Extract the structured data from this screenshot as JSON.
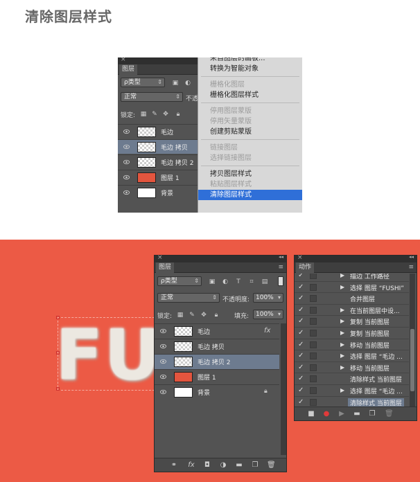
{
  "page_title": "清除图层样式",
  "top_panel": {
    "close": "×",
    "tab": "图层",
    "filter_label": "ρ类型",
    "blend_mode": "正常",
    "opacity_label": "不透",
    "lock_label": "锁定:",
    "layers": [
      {
        "name": "毛边",
        "thumb": "checker"
      },
      {
        "name": "毛边 拷贝",
        "thumb": "checker",
        "selected": true
      },
      {
        "name": "毛边 拷贝 2",
        "thumb": "checker"
      },
      {
        "name": "图层 1",
        "thumb": "#e3553e"
      },
      {
        "name": "背景",
        "thumb": "#ffffff"
      }
    ]
  },
  "context_menu": {
    "items": [
      {
        "label": "来自图层的画板...",
        "state": "normal"
      },
      {
        "label": "转换为智能对象",
        "state": "normal"
      },
      {
        "label": "栅格化图层",
        "state": "disabled"
      },
      {
        "label": "栅格化图层样式",
        "state": "normal"
      },
      {
        "label": "停用图层蒙版",
        "state": "disabled"
      },
      {
        "label": "停用矢量蒙版",
        "state": "disabled"
      },
      {
        "label": "创建剪贴蒙版",
        "state": "normal"
      },
      {
        "label": "链接图层",
        "state": "disabled"
      },
      {
        "label": "选择链接图层",
        "state": "disabled"
      },
      {
        "label": "拷贝图层样式",
        "state": "normal"
      },
      {
        "label": "粘贴图层样式",
        "state": "disabled"
      },
      {
        "label": "清除图层样式",
        "state": "highlight"
      }
    ]
  },
  "canvas": {
    "text": "FU",
    "background": "#ec5a45"
  },
  "layers_panel": {
    "close": "×",
    "collapse": "◂◂",
    "tab": "图层",
    "filter_label": "ρ类型",
    "blend_mode": "正常",
    "opacity_label": "不透明度:",
    "opacity_value": "100%",
    "lock_label": "锁定:",
    "fill_label": "填充:",
    "fill_value": "100%",
    "fx_badge": "fx",
    "layers": [
      {
        "name": "毛边",
        "thumb": "checker"
      },
      {
        "name": "毛边 拷贝",
        "thumb": "checker"
      },
      {
        "name": "毛边 拷贝 2",
        "thumb": "checker",
        "selected": true
      },
      {
        "name": "图层 1",
        "thumb": "#e3553e"
      },
      {
        "name": "背景",
        "thumb": "#ffffff"
      }
    ]
  },
  "actions_panel": {
    "close": "×",
    "collapse": "◂◂",
    "tab": "动作",
    "check": "✓",
    "triangle": "▶",
    "rows": [
      {
        "label": "描边 工作路径",
        "tri": true
      },
      {
        "label": "选择 图层 “FUSHI”",
        "tri": true
      },
      {
        "label": "合并图层",
        "tri": false
      },
      {
        "label": "在当前图层中设...",
        "tri": true
      },
      {
        "label": "复制 当前图层",
        "tri": true
      },
      {
        "label": "复制 当前图层",
        "tri": true
      },
      {
        "label": "移动 当前图层",
        "tri": true
      },
      {
        "label": "选择 图层 “毛边 ...",
        "tri": true
      },
      {
        "label": "移动 当前图层",
        "tri": true
      },
      {
        "label": "清除样式 当前图层",
        "tri": false
      },
      {
        "label": "选择 图层 “毛边 ...",
        "tri": true
      },
      {
        "label": "清除样式 当前图层",
        "tri": false,
        "selected": true
      }
    ]
  },
  "colors": {
    "panel_bg": "#535353",
    "selection": "#6d7b8f",
    "menu_highlight": "#2f6fd8",
    "canvas_orange": "#ec5a45",
    "record_red": "#e03a3a"
  }
}
